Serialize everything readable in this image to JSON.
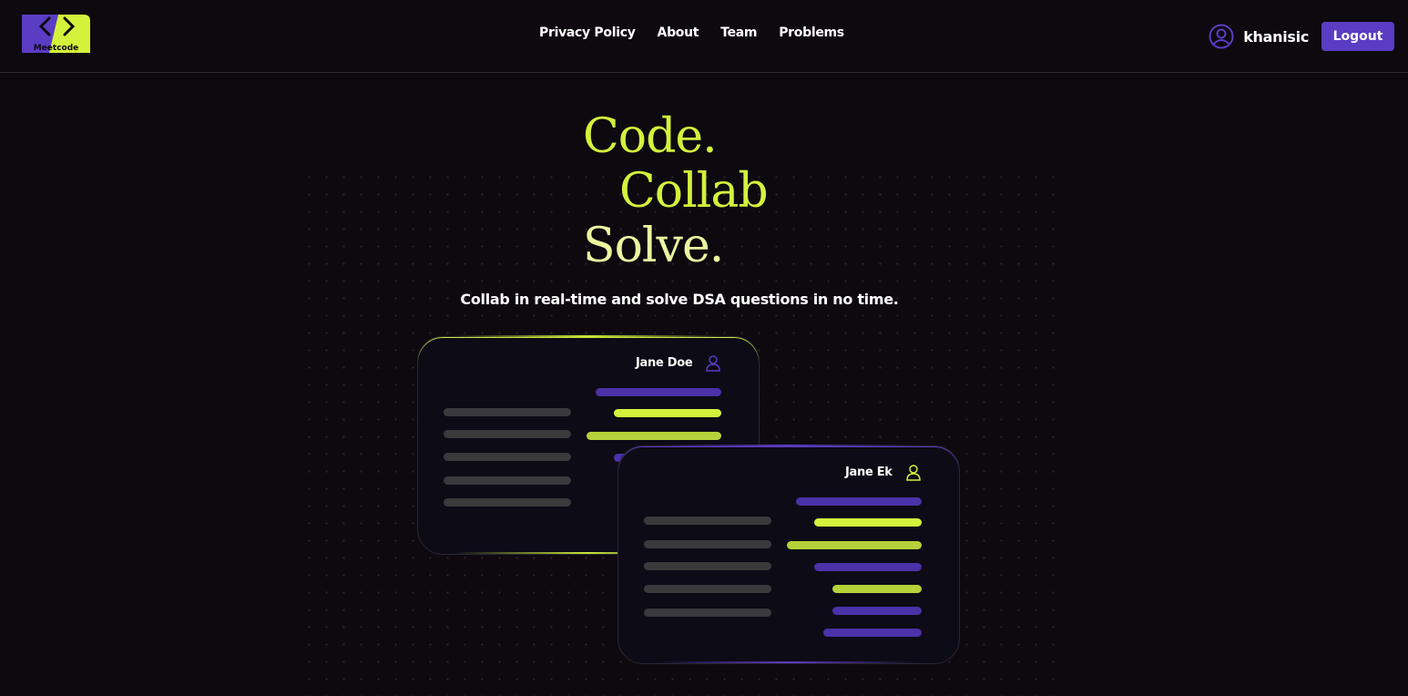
{
  "header": {
    "logo_text": "Meetcode",
    "nav": [
      "Privacy Policy",
      "About",
      "Team",
      "Problems"
    ],
    "username": "khanisic",
    "logout_label": "Logout"
  },
  "hero": {
    "line1": "Code.",
    "line2": "Collab",
    "line3": "Solve.",
    "tagline": "Collab in real-time and solve DSA questions in no time."
  },
  "cards": [
    {
      "name": "Jane Doe",
      "icon": "user-icon"
    },
    {
      "name": "Jane Ek",
      "icon": "user-icon"
    }
  ],
  "colors": {
    "accent_lime": "#d4f23c",
    "accent_purple": "#5b3cc4",
    "background": "#0e090f"
  }
}
